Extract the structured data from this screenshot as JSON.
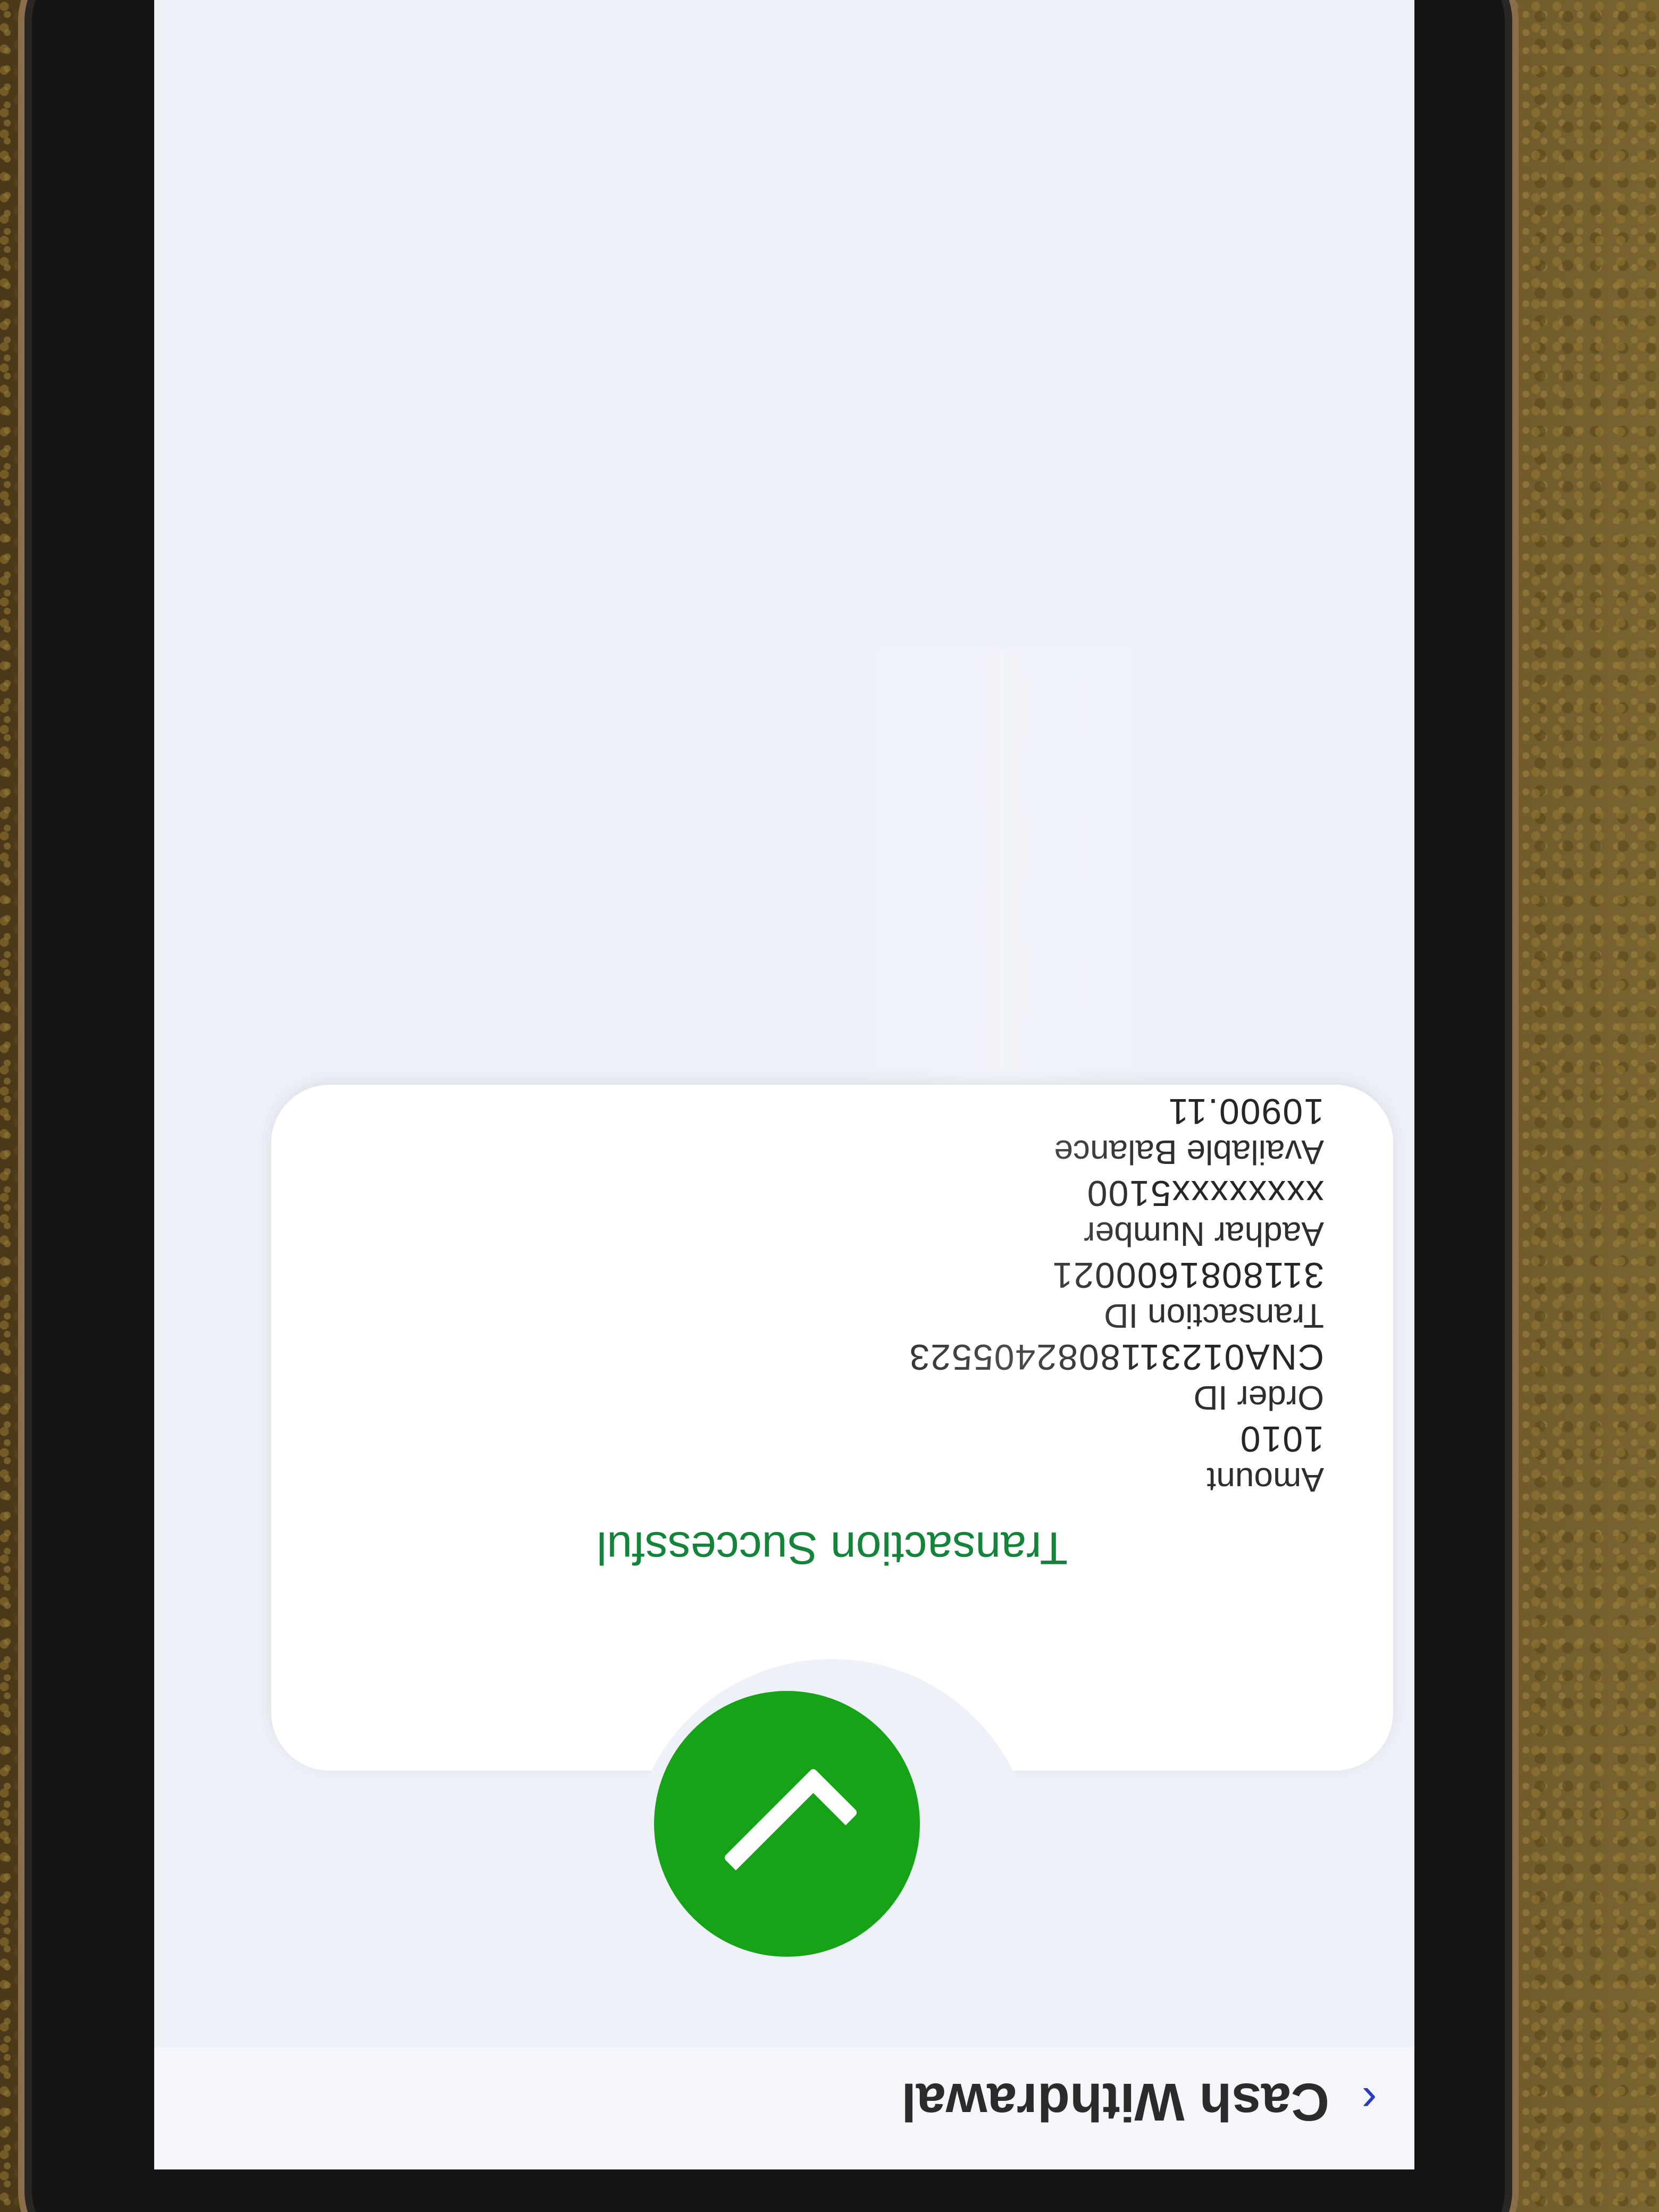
{
  "header": {
    "title": "Cash Withdrawal",
    "back_icon": "chevron-left-icon"
  },
  "status": {
    "icon": "check-icon",
    "title": "Transaction Successful",
    "color": "#14843a",
    "circle_color": "#16a318"
  },
  "details": [
    {
      "label": "Amount",
      "value": "1010"
    },
    {
      "label": "Order ID",
      "value": "CNA0123118082405523"
    },
    {
      "label": "Transaction ID",
      "value": "3118081600021"
    },
    {
      "label": "Aadhar Number",
      "value": "xxxxxxxx5100"
    },
    {
      "label": "Available Balance",
      "value": "10900.11"
    }
  ],
  "buttons": {
    "left_color": "#c4c7cf",
    "right_color": "#2232b8"
  }
}
